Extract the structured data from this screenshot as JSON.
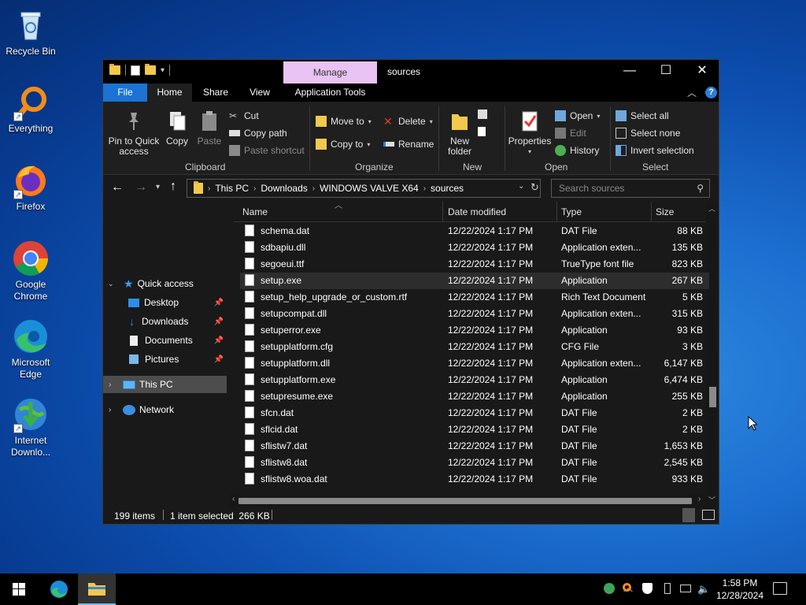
{
  "desktop": {
    "icons": [
      {
        "label": "Recycle Bin"
      },
      {
        "label": "Everything"
      },
      {
        "label": "Firefox"
      },
      {
        "label": "Google Chrome"
      },
      {
        "label": "Microsoft Edge"
      },
      {
        "label": "Internet Downlo..."
      }
    ]
  },
  "window": {
    "title": "sources",
    "manage_tab": "Manage",
    "menu_tabs": {
      "file": "File",
      "home": "Home",
      "share": "Share",
      "view": "View",
      "app_tools": "Application Tools"
    },
    "ribbon": {
      "clipboard": {
        "pin": "Pin to Quick access",
        "copy": "Copy",
        "paste": "Paste",
        "cut": "Cut",
        "copy_path": "Copy path",
        "paste_shortcut": "Paste shortcut",
        "label": "Clipboard"
      },
      "organize": {
        "move_to": "Move to",
        "copy_to": "Copy to",
        "delete": "Delete",
        "rename": "Rename",
        "label": "Organize"
      },
      "new": {
        "new_folder": "New folder",
        "label": "New"
      },
      "open": {
        "properties": "Properties",
        "open": "Open",
        "edit": "Edit",
        "history": "History",
        "label": "Open"
      },
      "select": {
        "select_all": "Select all",
        "select_none": "Select none",
        "invert": "Invert selection",
        "label": "Select"
      }
    },
    "address": {
      "crumbs": [
        "This PC",
        "Downloads",
        "WINDOWS VALVE X64",
        "sources"
      ]
    },
    "search_placeholder": "Search sources",
    "nav": {
      "quick_access": "Quick access",
      "desktop": "Desktop",
      "downloads": "Downloads",
      "documents": "Documents",
      "pictures": "Pictures",
      "this_pc": "This PC",
      "network": "Network"
    },
    "columns": {
      "name": "Name",
      "date": "Date modified",
      "type": "Type",
      "size": "Size"
    },
    "files": [
      {
        "name": "schema.dat",
        "date": "12/22/2024 1:17 PM",
        "type": "DAT File",
        "size": "88 KB"
      },
      {
        "name": "sdbapiu.dll",
        "date": "12/22/2024 1:17 PM",
        "type": "Application exten...",
        "size": "135 KB"
      },
      {
        "name": "segoeui.ttf",
        "date": "12/22/2024 1:17 PM",
        "type": "TrueType font file",
        "size": "823 KB"
      },
      {
        "name": "setup.exe",
        "date": "12/22/2024 1:17 PM",
        "type": "Application",
        "size": "267 KB"
      },
      {
        "name": "setup_help_upgrade_or_custom.rtf",
        "date": "12/22/2024 1:17 PM",
        "type": "Rich Text Document",
        "size": "5 KB"
      },
      {
        "name": "setupcompat.dll",
        "date": "12/22/2024 1:17 PM",
        "type": "Application exten...",
        "size": "315 KB"
      },
      {
        "name": "setuperror.exe",
        "date": "12/22/2024 1:17 PM",
        "type": "Application",
        "size": "93 KB"
      },
      {
        "name": "setupplatform.cfg",
        "date": "12/22/2024 1:17 PM",
        "type": "CFG File",
        "size": "3 KB"
      },
      {
        "name": "setupplatform.dll",
        "date": "12/22/2024 1:17 PM",
        "type": "Application exten...",
        "size": "6,147 KB"
      },
      {
        "name": "setupplatform.exe",
        "date": "12/22/2024 1:17 PM",
        "type": "Application",
        "size": "6,474 KB"
      },
      {
        "name": "setupresume.exe",
        "date": "12/22/2024 1:17 PM",
        "type": "Application",
        "size": "255 KB"
      },
      {
        "name": "sfcn.dat",
        "date": "12/22/2024 1:17 PM",
        "type": "DAT File",
        "size": "2 KB"
      },
      {
        "name": "sflcid.dat",
        "date": "12/22/2024 1:17 PM",
        "type": "DAT File",
        "size": "2 KB"
      },
      {
        "name": "sflistw7.dat",
        "date": "12/22/2024 1:17 PM",
        "type": "DAT File",
        "size": "1,653 KB"
      },
      {
        "name": "sflistw8.dat",
        "date": "12/22/2024 1:17 PM",
        "type": "DAT File",
        "size": "2,545 KB"
      },
      {
        "name": "sflistw8.woa.dat",
        "date": "12/22/2024 1:17 PM",
        "type": "DAT File",
        "size": "933 KB"
      }
    ],
    "status": {
      "items": "199 items",
      "selected": "1 item selected  266 KB"
    }
  },
  "taskbar": {
    "time": "1:58 PM",
    "date": "12/28/2024"
  }
}
